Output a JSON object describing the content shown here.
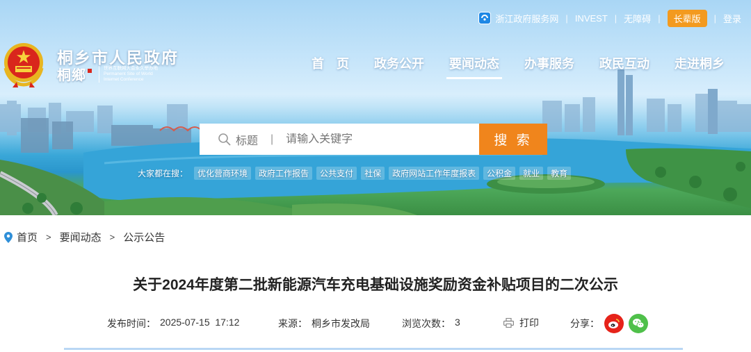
{
  "utility_bar": {
    "service_net": "浙江政府服务网",
    "invest": "INVEST",
    "accessible": "无障碍",
    "elder_mode": "长辈版",
    "login": "登录",
    "separator": "|"
  },
  "site": {
    "name": "桐乡市人民政府",
    "brand_calligraphy": "桐鄉",
    "slogan_lines": [
      "世界互联网大会永久举办地",
      "Permanent Site of World",
      "Internet Conference"
    ]
  },
  "nav": {
    "items": [
      "首　页",
      "政务公开",
      "要闻动态",
      "办事服务",
      "政民互动",
      "走进桐乡"
    ],
    "active_index": 2
  },
  "search": {
    "scope_label": "标题",
    "divider": "|",
    "placeholder": "请输入关键字",
    "button": "搜 索"
  },
  "hot_search": {
    "label": "大家都在搜：",
    "keywords": [
      "优化营商环境",
      "政府工作报告",
      "公共支付",
      "社保",
      "政府网站工作年度报表",
      "公积金",
      "就业",
      "教育"
    ]
  },
  "breadcrumb": {
    "items": [
      "首页",
      "要闻动态",
      "公示公告"
    ],
    "separator": ">"
  },
  "article": {
    "title": "关于2024年度第二批新能源汽车充电基础设施奖励资金补贴项目的二次公示",
    "publish_time_label": "发布时间：",
    "publish_time": "2025-07-15  17:12",
    "source_label": "来源：",
    "source": "桐乡市发改局",
    "views_label": "浏览次数：",
    "views": "3",
    "print": "打印",
    "share_label": "分享："
  },
  "colors": {
    "search_button": "#f0851c",
    "elder_button": "#f39a1f",
    "weibo": "#e6231a",
    "wechat": "#4fc04a",
    "divider": "#b9d7f4"
  },
  "icons": [
    "zhejiang-service-icon",
    "national-emblem-icon",
    "search-icon",
    "location-pin-icon",
    "print-icon",
    "weibo-icon",
    "wechat-icon"
  ]
}
